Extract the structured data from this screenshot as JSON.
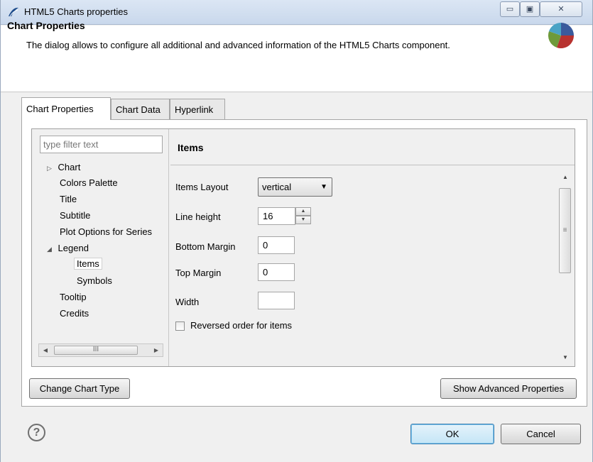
{
  "window": {
    "title": "HTML5 Charts properties",
    "controls": {
      "minimize": "▭",
      "maximize": "▣",
      "close": "✕"
    }
  },
  "header": {
    "title": "Chart Properties",
    "description": "The dialog allows to configure all additional and advanced information of the HTML5 Charts component.",
    "icon": "pie-chart-icon"
  },
  "tabs": [
    {
      "label": "Chart Properties",
      "active": true
    },
    {
      "label": "Chart Data",
      "active": false
    },
    {
      "label": "Hyperlink",
      "active": false
    }
  ],
  "tree": {
    "filter_placeholder": "type filter text",
    "items": [
      {
        "label": "Chart",
        "toggle": "▷"
      },
      {
        "label": "Colors Palette"
      },
      {
        "label": "Title"
      },
      {
        "label": "Subtitle"
      },
      {
        "label": "Plot Options for Series"
      },
      {
        "label": "Legend",
        "toggle": "◢"
      },
      {
        "label": "Items",
        "selected": true
      },
      {
        "label": "Symbols"
      },
      {
        "label": "Tooltip"
      },
      {
        "label": "Credits"
      }
    ],
    "scroll_grip": "III"
  },
  "properties": {
    "title": "Items",
    "items_layout_label": "Items Layout",
    "items_layout_value": "vertical",
    "line_height_label": "Line height",
    "line_height_value": "16",
    "bottom_margin_label": "Bottom Margin",
    "bottom_margin_value": "0",
    "top_margin_label": "Top Margin",
    "top_margin_value": "0",
    "width_label": "Width",
    "width_value": "",
    "reversed_label": "Reversed order for items",
    "reversed_checked": false
  },
  "buttons": {
    "change_chart_type": "Change Chart Type",
    "show_advanced": "Show Advanced Properties",
    "ok": "OK",
    "cancel": "Cancel",
    "help": "?"
  },
  "colors": {
    "pie": [
      "#3a5a9c",
      "#b8322f",
      "#6e9a3a",
      "#4aa3c5"
    ]
  }
}
